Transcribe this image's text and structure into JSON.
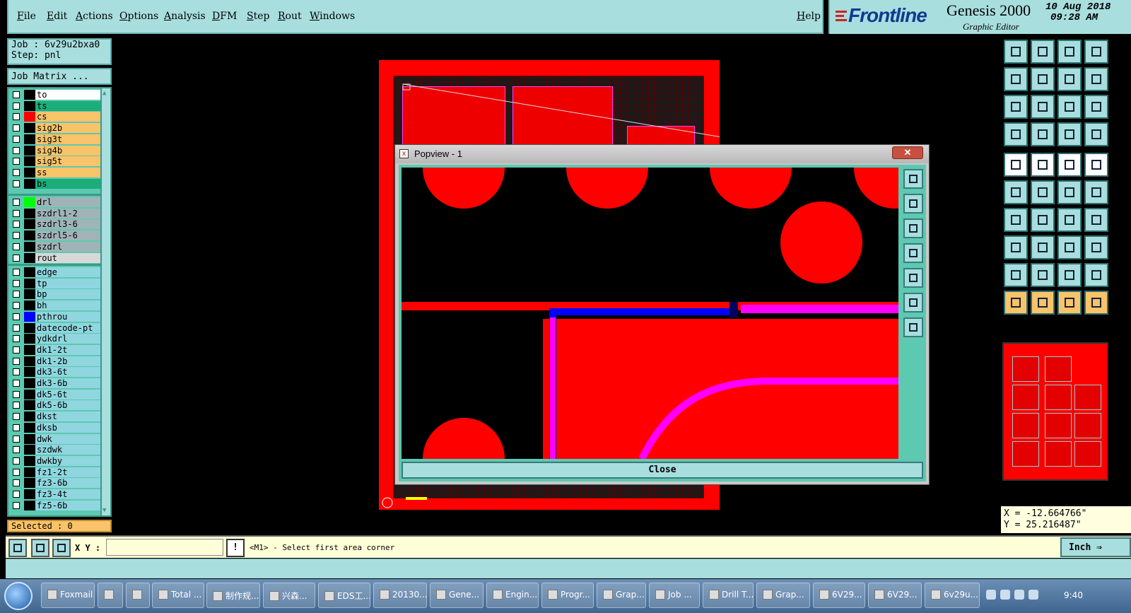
{
  "menu": {
    "items": [
      "File",
      "Edit",
      "Actions",
      "Options",
      "Analysis",
      "DFM",
      "Step",
      "Rout",
      "Windows"
    ],
    "help": "Help"
  },
  "branding": {
    "brand": "Frontline",
    "product": "Genesis 2000",
    "subtitle": "Graphic Editor",
    "date": "10 Aug 2018",
    "time": "09:28 AM"
  },
  "job": {
    "job_line": "Job : 6v29u2bxa0",
    "step_line": "Step: pnl",
    "matrix_button": "Job Matrix ..."
  },
  "layers": {
    "group1": [
      {
        "name": "to",
        "color": "#ffffff",
        "swatch": "#000000"
      },
      {
        "name": "ts",
        "color": "#1bae7a",
        "swatch": "#000000"
      },
      {
        "name": "cs",
        "color": "#f9c36a",
        "swatch": "#ff0000"
      },
      {
        "name": "sig2b",
        "color": "#f9c36a",
        "swatch": "#000000"
      },
      {
        "name": "sig3t",
        "color": "#f9c36a",
        "swatch": "#000000"
      },
      {
        "name": "sig4b",
        "color": "#f9c36a",
        "swatch": "#000000"
      },
      {
        "name": "sig5t",
        "color": "#f9c36a",
        "swatch": "#000000"
      },
      {
        "name": "ss",
        "color": "#f9c36a",
        "swatch": "#000000"
      },
      {
        "name": "bs",
        "color": "#1bae7a",
        "swatch": "#000000"
      }
    ],
    "group2": [
      {
        "name": "drl",
        "color": "#a0b4b8",
        "swatch": "#00ff00"
      },
      {
        "name": "szdrl1-2",
        "color": "#a0b4b8",
        "swatch": "#000000"
      },
      {
        "name": "szdrl3-6",
        "color": "#a0b4b8",
        "swatch": "#000000"
      },
      {
        "name": "szdrl5-6",
        "color": "#a0b4b8",
        "swatch": "#000000"
      },
      {
        "name": "szdrl",
        "color": "#a0b4b8",
        "swatch": "#000000"
      },
      {
        "name": "rout",
        "color": "#d8d8d8",
        "swatch": "#000000"
      }
    ],
    "group3": [
      {
        "name": "edge",
        "color": "#8fd6df",
        "swatch": "#000000"
      },
      {
        "name": "tp",
        "color": "#8fd6df",
        "swatch": "#000000"
      },
      {
        "name": "bp",
        "color": "#8fd6df",
        "swatch": "#000000"
      },
      {
        "name": "bh",
        "color": "#8fd6df",
        "swatch": "#000000"
      },
      {
        "name": "pthrou",
        "color": "#8fd6df",
        "swatch": "#0000ff"
      },
      {
        "name": "datecode-pt",
        "color": "#8fd6df",
        "swatch": "#000000"
      },
      {
        "name": "ydkdrl",
        "color": "#8fd6df",
        "swatch": "#000000"
      },
      {
        "name": "dk1-2t",
        "color": "#8fd6df",
        "swatch": "#000000"
      },
      {
        "name": "dk1-2b",
        "color": "#8fd6df",
        "swatch": "#000000"
      },
      {
        "name": "dk3-6t",
        "color": "#8fd6df",
        "swatch": "#000000"
      },
      {
        "name": "dk3-6b",
        "color": "#8fd6df",
        "swatch": "#000000"
      },
      {
        "name": "dk5-6t",
        "color": "#8fd6df",
        "swatch": "#000000"
      },
      {
        "name": "dk5-6b",
        "color": "#8fd6df",
        "swatch": "#000000"
      },
      {
        "name": "dkst",
        "color": "#8fd6df",
        "swatch": "#000000"
      },
      {
        "name": "dksb",
        "color": "#8fd6df",
        "swatch": "#000000"
      },
      {
        "name": "dwk",
        "color": "#8fd6df",
        "swatch": "#000000"
      },
      {
        "name": "szdwk",
        "color": "#8fd6df",
        "swatch": "#000000"
      },
      {
        "name": "dwkby",
        "color": "#8fd6df",
        "swatch": "#000000"
      },
      {
        "name": "fz1-2t",
        "color": "#8fd6df",
        "swatch": "#000000"
      },
      {
        "name": "fz3-6b",
        "color": "#8fd6df",
        "swatch": "#000000"
      },
      {
        "name": "fz3-4t",
        "color": "#8fd6df",
        "swatch": "#000000"
      },
      {
        "name": "fz5-6b",
        "color": "#8fd6df",
        "swatch": "#000000"
      }
    ]
  },
  "selected": "Selected : 0",
  "popview": {
    "title": "Popview - 1",
    "close_x": "✕",
    "close_button": "Close",
    "tool_icons": [
      "zoom-window-icon",
      "pan-up-icon",
      "pan-down-icon",
      "pan-left-icon",
      "pan-right-icon",
      "zoom-out-icon",
      "zoom-home-icon"
    ]
  },
  "coords": {
    "x": "X = -12.664766\"",
    "y": "Y = 25.216487\""
  },
  "command": {
    "xy_label": "X Y :",
    "xy_value": "",
    "warn": "!",
    "prompt": "<M1> - Select first area corner",
    "units": "Inch ⇒"
  },
  "taskbar": {
    "tasks": [
      "Foxmail",
      "",
      "",
      "Total ...",
      "制作规...",
      "兴森...",
      "EDS工...",
      "20130...",
      "Gene...",
      "Engin...",
      "Progr...",
      "Grap...",
      "Job ...",
      "Drill T...",
      "Grap...",
      "6V29...",
      "6V29...",
      "6v29u..."
    ],
    "clock": "9:40"
  }
}
